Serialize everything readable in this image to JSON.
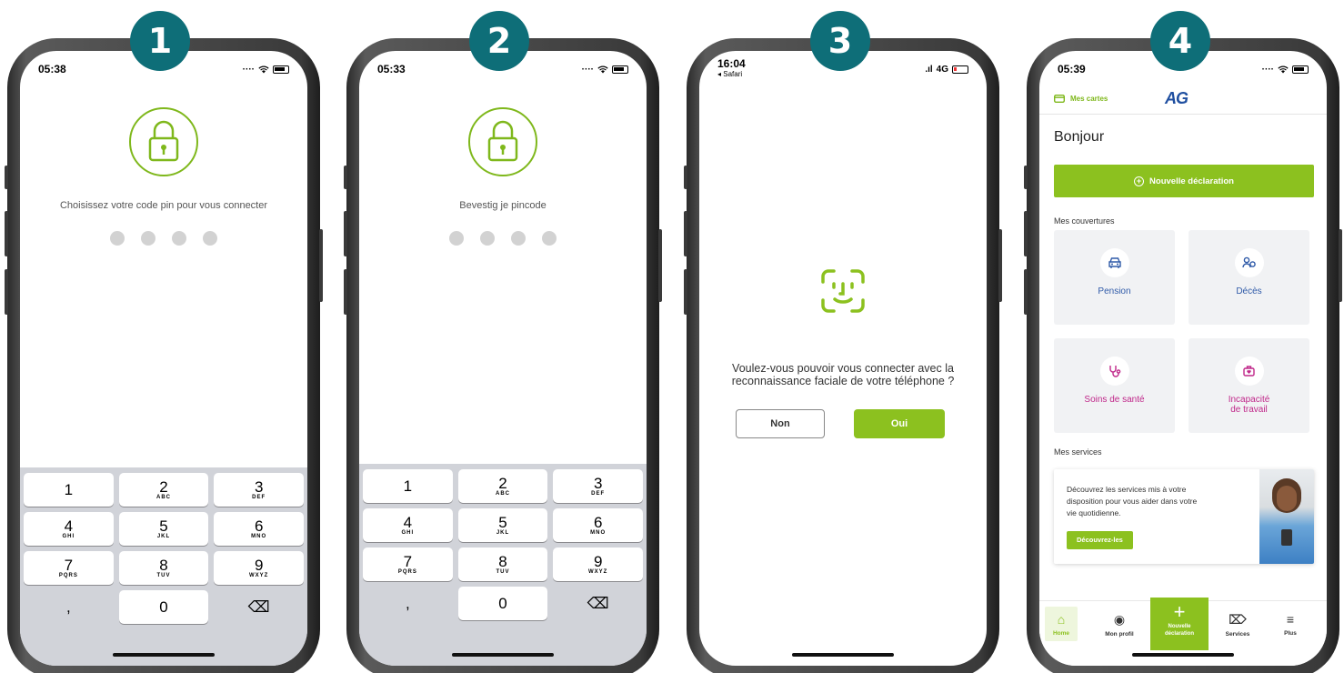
{
  "steps": [
    "1",
    "2",
    "3",
    "4"
  ],
  "accent": "#8cc11f",
  "badge_color": "#0e6e78",
  "keypad": [
    [
      {
        "d": "1",
        "l": ""
      },
      {
        "d": "2",
        "l": "ABC"
      },
      {
        "d": "3",
        "l": "DEF"
      }
    ],
    [
      {
        "d": "4",
        "l": "GHI"
      },
      {
        "d": "5",
        "l": "JKL"
      },
      {
        "d": "6",
        "l": "MNO"
      }
    ],
    [
      {
        "d": "7",
        "l": "PQRS"
      },
      {
        "d": "8",
        "l": "TUV"
      },
      {
        "d": "9",
        "l": "WXYZ"
      }
    ],
    [
      {
        "d": ",",
        "l": ""
      },
      {
        "d": "0",
        "l": ""
      },
      {
        "d": "⌫",
        "l": ""
      }
    ]
  ],
  "screen1": {
    "time": "05:38",
    "label": "Choisissez votre code pin pour vous connecter"
  },
  "screen2": {
    "time": "05:33",
    "label": "Bevestig je pincode"
  },
  "screen3": {
    "time": "16:04",
    "back": "◂ Safari",
    "network": "4G",
    "message_line1": "Voulez-vous pouvoir vous connecter avec la",
    "message_line2": "reconnaissance faciale de votre téléphone ?",
    "no": "Non",
    "yes": "Oui"
  },
  "screen4": {
    "time": "05:39",
    "my_cards": "Mes cartes",
    "logo": "AG",
    "greeting": "Bonjour",
    "new_claim": "Nouvelle déclaration",
    "coverages_title": "Mes couvertures",
    "tiles": [
      {
        "label": "Pension",
        "icon": "car-icon",
        "color": "#2f5aa8"
      },
      {
        "label": "Décès",
        "icon": "people-icon",
        "color": "#2f5aa8"
      },
      {
        "label": "Soins de santé",
        "icon": "stethoscope-icon",
        "color": "#c0288a"
      },
      {
        "label": "Incapacité",
        "label2": "de travail",
        "icon": "briefcase-heart-icon",
        "color": "#c0288a"
      }
    ],
    "services_title": "Mes services",
    "services_text1": "Découvrez les services mis à votre",
    "services_text2": "disposition pour vous aider dans votre",
    "services_text3": "vie quotidienne.",
    "services_btn": "Découvrez-les",
    "tabs": {
      "home": "Home",
      "profile": "Mon profil",
      "new1": "Nouvelle",
      "new2": "déclaration",
      "services": "Services",
      "more": "Plus"
    }
  }
}
